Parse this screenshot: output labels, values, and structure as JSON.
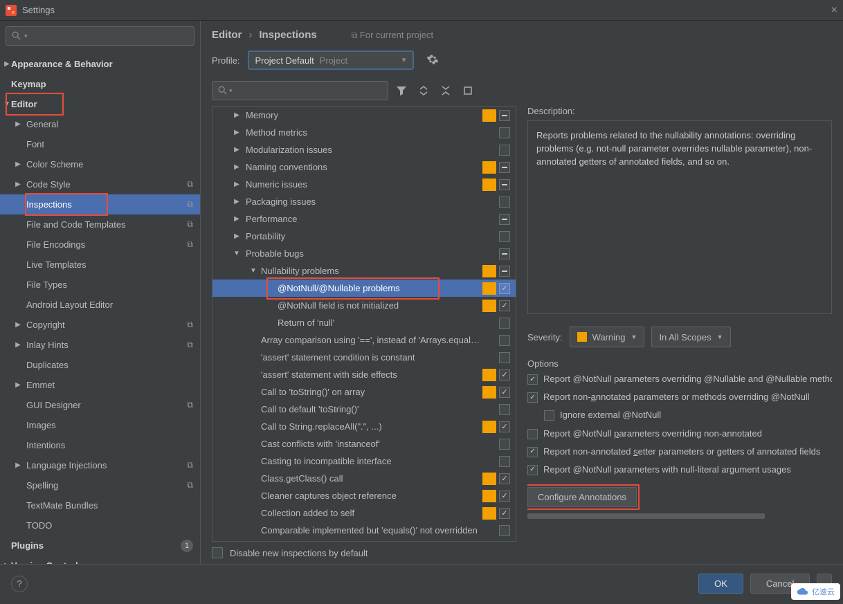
{
  "window": {
    "title": "Settings"
  },
  "breadcrumb": {
    "a": "Editor",
    "b": "Inspections",
    "hint": "For current project"
  },
  "profile": {
    "label": "Profile:",
    "name": "Project Default",
    "scope": "Project"
  },
  "sidebar": {
    "items": [
      {
        "label": "Appearance & Behavior",
        "bold": true,
        "arrow": "▶",
        "level": 0
      },
      {
        "label": "Keymap",
        "bold": true,
        "level": 0
      },
      {
        "label": "Editor",
        "bold": true,
        "arrow": "▼",
        "level": 0,
        "red": true
      },
      {
        "label": "General",
        "arrow": "▶",
        "level": 1
      },
      {
        "label": "Font",
        "level": 1
      },
      {
        "label": "Color Scheme",
        "arrow": "▶",
        "level": 1
      },
      {
        "label": "Code Style",
        "arrow": "▶",
        "level": 1,
        "badge": true
      },
      {
        "label": "Inspections",
        "level": 1,
        "badge": true,
        "selected": true,
        "red": true
      },
      {
        "label": "File and Code Templates",
        "level": 1,
        "badge": true
      },
      {
        "label": "File Encodings",
        "level": 1,
        "badge": true
      },
      {
        "label": "Live Templates",
        "level": 1
      },
      {
        "label": "File Types",
        "level": 1
      },
      {
        "label": "Android Layout Editor",
        "level": 1
      },
      {
        "label": "Copyright",
        "arrow": "▶",
        "level": 1,
        "badge": true
      },
      {
        "label": "Inlay Hints",
        "arrow": "▶",
        "level": 1,
        "badge": true
      },
      {
        "label": "Duplicates",
        "level": 1
      },
      {
        "label": "Emmet",
        "arrow": "▶",
        "level": 1
      },
      {
        "label": "GUI Designer",
        "level": 1,
        "badge": true
      },
      {
        "label": "Images",
        "level": 1
      },
      {
        "label": "Intentions",
        "level": 1
      },
      {
        "label": "Language Injections",
        "arrow": "▶",
        "level": 1,
        "badge": true
      },
      {
        "label": "Spelling",
        "level": 1,
        "badge": true
      },
      {
        "label": "TextMate Bundles",
        "level": 1
      },
      {
        "label": "TODO",
        "level": 1
      },
      {
        "label": "Plugins",
        "bold": true,
        "level": 0,
        "count": "1"
      },
      {
        "label": "Version Control",
        "bold": true,
        "arrow": "▶",
        "level": 0
      }
    ]
  },
  "inspections": [
    {
      "label": "Memory",
      "depth": 1,
      "arrow": "▶",
      "swatch": true,
      "cb": "mixed"
    },
    {
      "label": "Method metrics",
      "depth": 1,
      "arrow": "▶",
      "cb": "empty"
    },
    {
      "label": "Modularization issues",
      "depth": 1,
      "arrow": "▶",
      "cb": "empty"
    },
    {
      "label": "Naming conventions",
      "depth": 1,
      "arrow": "▶",
      "swatch": true,
      "cb": "mixed"
    },
    {
      "label": "Numeric issues",
      "depth": 1,
      "arrow": "▶",
      "swatch": true,
      "cb": "mixed"
    },
    {
      "label": "Packaging issues",
      "depth": 1,
      "arrow": "▶",
      "cb": "empty"
    },
    {
      "label": "Performance",
      "depth": 1,
      "arrow": "▶",
      "cb": "mixed"
    },
    {
      "label": "Portability",
      "depth": 1,
      "arrow": "▶",
      "cb": "empty"
    },
    {
      "label": "Probable bugs",
      "depth": 1,
      "arrow": "▼",
      "cb": "mixed"
    },
    {
      "label": "Nullability problems",
      "depth": 2,
      "arrow": "▼",
      "swatch": true,
      "cb": "mixed"
    },
    {
      "label": "@NotNull/@Nullable problems",
      "depth": 4,
      "swatch": true,
      "cb": "checked",
      "selected": true,
      "red": true
    },
    {
      "label": "@NotNull field is not initialized",
      "depth": 4,
      "swatch": true,
      "cb": "checked"
    },
    {
      "label": "Return of 'null'",
      "depth": 4,
      "cb": "empty"
    },
    {
      "label": "Array comparison using '==', instead of 'Arrays.equals()'",
      "depth": 3,
      "cb": "empty"
    },
    {
      "label": "'assert' statement condition is constant",
      "depth": 3,
      "cb": "empty"
    },
    {
      "label": "'assert' statement with side effects",
      "depth": 3,
      "swatch": true,
      "cb": "checked"
    },
    {
      "label": "Call to 'toString()' on array",
      "depth": 3,
      "swatch": true,
      "cb": "checked"
    },
    {
      "label": "Call to default 'toString()'",
      "depth": 3,
      "cb": "empty"
    },
    {
      "label": "Call to String.replaceAll(\".\", ...)",
      "depth": 3,
      "swatch": true,
      "cb": "checked"
    },
    {
      "label": "Cast conflicts with 'instanceof'",
      "depth": 3,
      "cb": "empty"
    },
    {
      "label": "Casting to incompatible interface",
      "depth": 3,
      "cb": "empty"
    },
    {
      "label": "Class.getClass() call",
      "depth": 3,
      "swatch": true,
      "cb": "checked"
    },
    {
      "label": "Cleaner captures object reference",
      "depth": 3,
      "swatch": true,
      "cb": "checked"
    },
    {
      "label": "Collection added to self",
      "depth": 3,
      "swatch": true,
      "cb": "checked"
    },
    {
      "label": "Comparable implemented but 'equals()' not overridden",
      "depth": 3,
      "cb": "empty"
    }
  ],
  "description": {
    "label": "Description:",
    "text": "Reports problems related to the nullability annotations: overriding problems (e.g. not-null parameter overrides nullable parameter), non-annotated getters of annotated fields, and so on."
  },
  "severity": {
    "label": "Severity:",
    "value": "Warning",
    "scope": "In All Scopes"
  },
  "options": {
    "title": "Options",
    "items": [
      {
        "text": "Report @NotNull parameters overriding @Nullable and @Nullable methods overriding @NotNull",
        "checked": true
      },
      {
        "text": "Report non-annotated parameters or methods overriding @NotNull",
        "checked": true,
        "underline_idx": 11
      },
      {
        "text": "Ignore external @NotNull",
        "checked": false,
        "indent": true
      },
      {
        "text": "Report @NotNull parameters overriding non-annotated",
        "checked": false,
        "underline_idx": 16
      },
      {
        "text": "Report non-annotated setter parameters or getters of annotated fields",
        "checked": true,
        "underline_idx": 21
      },
      {
        "text": "Report @NotNull parameters with null-literal argument usages",
        "checked": true
      }
    ],
    "configure": "Configure Annotations"
  },
  "disable_new": "Disable new inspections by default",
  "buttons": {
    "ok": "OK",
    "cancel": "Cancel",
    "help": "?"
  },
  "watermark": "亿速云"
}
